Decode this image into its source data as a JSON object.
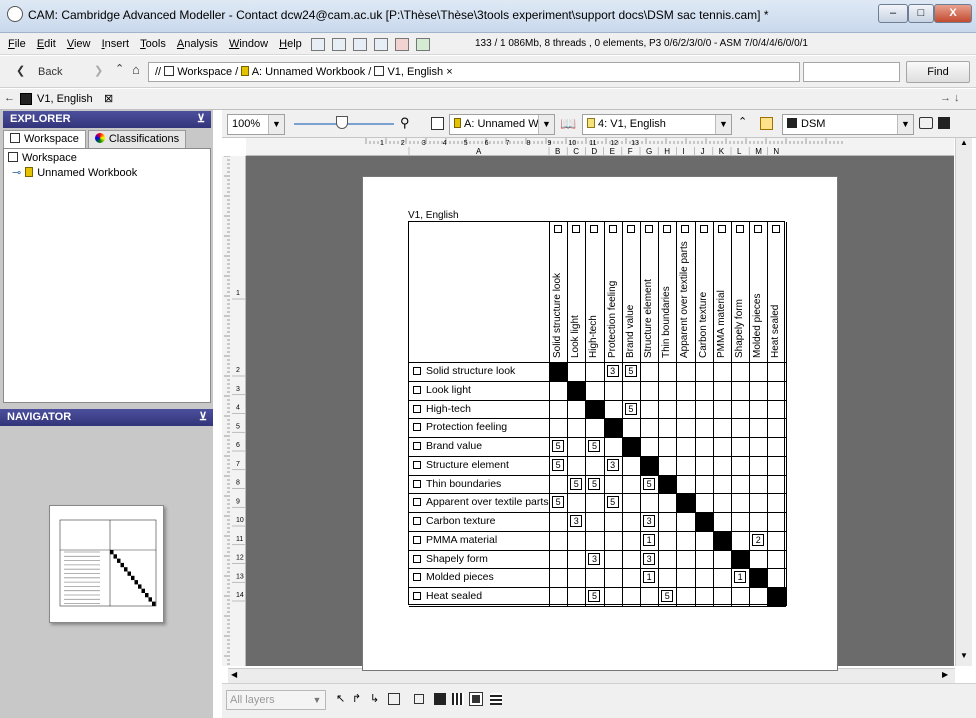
{
  "window": {
    "title": "CAM: Cambridge Advanced Modeller - Contact dcw24@cam.ac.uk [P:\\Thèse\\Thèse\\3tools experiment\\support docs\\DSM sac tennis.cam] *",
    "min": "–",
    "max": "□",
    "close": "X"
  },
  "menu": [
    "File",
    "Edit",
    "View",
    "Insert",
    "Tools",
    "Analysis",
    "Window",
    "Help"
  ],
  "status": "133 / 1 086Mb, 8 threads , 0 elements, P3 0/6/2/3/0/0 - ASM 7/0/4/4/6/0/0/1",
  "nav": {
    "back": "Back",
    "address_prefix": "//",
    "address_workspace": "Workspace",
    "address_workbook": "A: Unnamed Workbook",
    "address_view": "V1, English",
    "address_close": "×",
    "find": "Find",
    "tab": "V1, English"
  },
  "explorer": {
    "title": "EXPLORER",
    "tabs": [
      "Workspace",
      "Classifications"
    ],
    "tree": [
      "Workspace",
      "Unnamed Workbook"
    ]
  },
  "navigator": {
    "title": "NAVIGATOR"
  },
  "toolbar": {
    "zoom": "100%",
    "workbook": "A: Unnamed W...",
    "view": "4: V1, English",
    "type": "DSM"
  },
  "ruler": {
    "numbers": [
      "1",
      "2",
      "3",
      "4",
      "5",
      "6",
      "7",
      "8",
      "9",
      "10",
      "11",
      "12",
      "13"
    ],
    "columns": [
      "A",
      "B",
      "C",
      "D",
      "E",
      "F",
      "G",
      "H",
      "I",
      "J",
      "K",
      "L",
      "M",
      "N"
    ],
    "rows": [
      "1",
      "2",
      "3",
      "4",
      "5",
      "6",
      "7",
      "8",
      "9",
      "10",
      "11",
      "12",
      "13",
      "14"
    ]
  },
  "bottom": {
    "layers": "All layers"
  },
  "dsm": {
    "caption": "V1, English",
    "elements": [
      "Solid structure look",
      "Look light",
      "High-tech",
      "Protection feeling",
      "Brand value",
      "Structure element",
      "Thin boundaries",
      "Apparent over textile parts",
      "Carbon texture",
      "PMMA material",
      "Shapely form",
      "Molded pieces",
      "Heat sealed"
    ],
    "matrix": [
      [
        "X",
        "",
        "",
        "3",
        "5",
        "",
        "",
        "",
        "",
        "",
        "",
        "",
        ""
      ],
      [
        "",
        "X",
        "",
        "",
        "",
        "",
        "",
        "",
        "",
        "",
        "",
        "",
        ""
      ],
      [
        "",
        "",
        "X",
        "",
        "5",
        "",
        "",
        "",
        "",
        "",
        "",
        "",
        ""
      ],
      [
        "",
        "",
        "",
        "X",
        "",
        "",
        "",
        "",
        "",
        "",
        "",
        "",
        ""
      ],
      [
        "5",
        "",
        "5",
        "",
        "X",
        "",
        "",
        "",
        "",
        "",
        "",
        "",
        ""
      ],
      [
        "5",
        "",
        "",
        "3",
        "",
        "X",
        "",
        "",
        "",
        "",
        "",
        "",
        ""
      ],
      [
        "",
        "5",
        "5",
        "",
        "",
        "5",
        "X",
        "",
        "",
        "",
        "",
        "",
        ""
      ],
      [
        "5",
        "",
        "",
        "5",
        "",
        "",
        "",
        "X",
        "",
        "",
        "",
        "",
        ""
      ],
      [
        "",
        "3",
        "",
        "",
        "",
        "3",
        "",
        "",
        "X",
        "",
        "",
        "",
        ""
      ],
      [
        "",
        "",
        "",
        "",
        "",
        "1",
        "",
        "",
        "",
        "X",
        "",
        "2",
        ""
      ],
      [
        "",
        "",
        "3",
        "",
        "",
        "3",
        "",
        "",
        "",
        "",
        "X",
        "",
        ""
      ],
      [
        "",
        "",
        "",
        "",
        "",
        "1",
        "",
        "",
        "",
        "",
        "1",
        "X",
        ""
      ],
      [
        "",
        "",
        "5",
        "",
        "",
        "",
        "5",
        "",
        "",
        "",
        "",
        "",
        "X"
      ]
    ]
  }
}
